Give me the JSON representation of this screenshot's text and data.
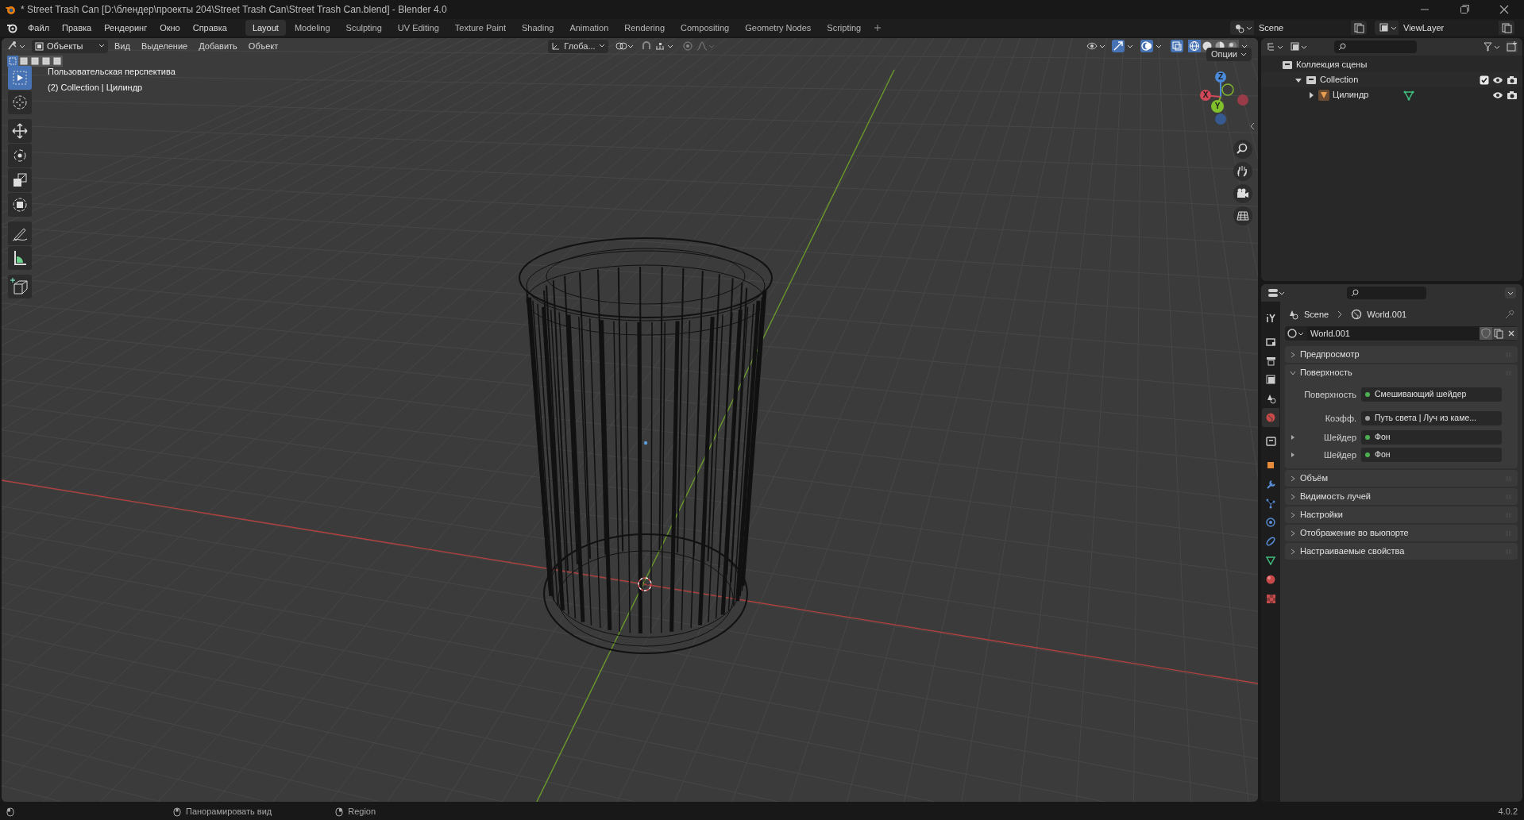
{
  "window": {
    "title": "* Street Trash Can [D:\\блендер\\проекты 204\\Street Trash Can\\Street Trash Can.blend] - Blender 4.0"
  },
  "menu": [
    "Файл",
    "Правка",
    "Рендеринг",
    "Окно",
    "Справка"
  ],
  "workspaces": [
    {
      "label": "Layout",
      "selected": true
    },
    {
      "label": "Modeling",
      "selected": false
    },
    {
      "label": "Sculpting",
      "selected": false
    },
    {
      "label": "UV Editing",
      "selected": false
    },
    {
      "label": "Texture Paint",
      "selected": false
    },
    {
      "label": "Shading",
      "selected": false
    },
    {
      "label": "Animation",
      "selected": false
    },
    {
      "label": "Rendering",
      "selected": false
    },
    {
      "label": "Compositing",
      "selected": false
    },
    {
      "label": "Geometry Nodes",
      "selected": false
    },
    {
      "label": "Scripting",
      "selected": false
    }
  ],
  "scene": "Scene",
  "view_layer": "ViewLayer",
  "viewport": {
    "mode": "Объекты",
    "menus": [
      "Вид",
      "Выделение",
      "Добавить",
      "Объект"
    ],
    "orientation": "Глоба...",
    "options": "Опции",
    "info": [
      "Пользовательская перспектива",
      "(2) Collection | Цилиндр"
    ],
    "select_modes": [
      {
        "selected": true
      },
      {
        "selected": false
      },
      {
        "selected": false
      },
      {
        "selected": false
      },
      {
        "selected": false
      }
    ],
    "tools": [
      {
        "kind": "select",
        "selected": true
      },
      {
        "kind": "cursor",
        "selected": false
      },
      {
        "kind": "move",
        "selected": false
      },
      {
        "kind": "rotate",
        "selected": false
      },
      {
        "kind": "scale",
        "selected": false
      },
      {
        "kind": "transform",
        "selected": false
      },
      {
        "kind": "annotate",
        "selected": false
      },
      {
        "kind": "measure",
        "selected": false
      },
      {
        "kind": "add-cube",
        "selected": false
      }
    ],
    "shading": [
      {
        "kind": "wireframe",
        "selected": true
      },
      {
        "kind": "solid",
        "selected": false
      },
      {
        "kind": "material",
        "selected": false
      },
      {
        "kind": "rendered",
        "selected": false
      }
    ],
    "gizmo_axes": [
      {
        "label": "Z"
      },
      {
        "label": "X"
      },
      {
        "label": "Y"
      }
    ]
  },
  "outliner": {
    "items": [
      {
        "label": "Коллекция сцены",
        "kind": "scene-collection",
        "children": [
          {
            "label": "Collection",
            "kind": "collection",
            "expanded": true,
            "checked": true,
            "children": [
              {
                "label": "Цилиндр",
                "kind": "object",
                "expanded": false
              }
            ]
          }
        ]
      }
    ]
  },
  "properties": {
    "breadcrumb": [
      "Scene",
      "World.001"
    ],
    "world_name": "World.001",
    "tabs": [
      {
        "kind": "tool",
        "selected": false
      },
      {
        "kind": "render",
        "selected": false
      },
      {
        "kind": "output",
        "selected": false
      },
      {
        "kind": "view-layer",
        "selected": false
      },
      {
        "kind": "scene",
        "selected": false
      },
      {
        "kind": "world",
        "selected": true
      },
      {
        "kind": "collection",
        "selected": false
      },
      {
        "kind": "object",
        "selected": false
      },
      {
        "kind": "modifier",
        "selected": false
      },
      {
        "kind": "particles",
        "selected": false
      },
      {
        "kind": "physics",
        "selected": false
      },
      {
        "kind": "constraints",
        "selected": false
      },
      {
        "kind": "data",
        "selected": false
      },
      {
        "kind": "material",
        "selected": false
      },
      {
        "kind": "texture",
        "selected": false
      }
    ],
    "panels": [
      {
        "label": "Предпросмотр",
        "expanded": false
      },
      {
        "label": "Поверхность",
        "expanded": true,
        "fields": [
          {
            "kind": "socket",
            "label": "Поверхность",
            "value": "Смешивающий шейдер",
            "color": "#4caf50"
          },
          {
            "kind": "socket",
            "label": "Коэфф.",
            "value": "Путь света | Луч из каме...",
            "color": "#a1a1a1"
          },
          {
            "kind": "shader",
            "label": "Шейдер",
            "value": "Фон",
            "color": "#4caf50"
          },
          {
            "kind": "shader",
            "label": "Шейдер",
            "value": "Фон",
            "color": "#4caf50"
          }
        ]
      },
      {
        "label": "Объём",
        "expanded": false
      },
      {
        "label": "Видимость лучей",
        "expanded": false
      },
      {
        "label": "Настройки",
        "expanded": false
      },
      {
        "label": "Отображение во вьюпорте",
        "expanded": false
      },
      {
        "label": "Настраиваемые свойства",
        "expanded": false
      }
    ]
  },
  "status_bar": {
    "hints": [
      "Панорамировать вид",
      "Region"
    ],
    "version": "4.0.2"
  }
}
